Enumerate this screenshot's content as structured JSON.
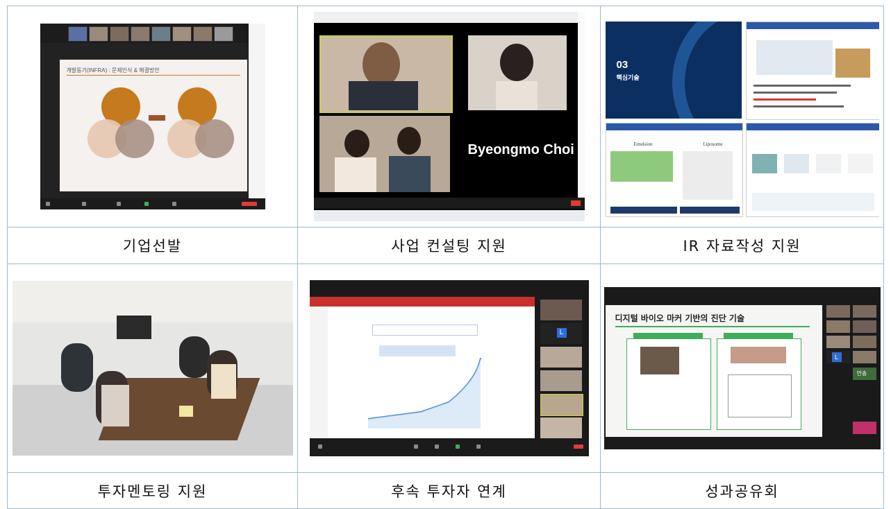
{
  "captions": {
    "c1": "기업선발",
    "c2": "사업 컨설팅 지원",
    "c3": "IR 자료작성 지원",
    "c4": "투자멘토링 지원",
    "c5": "후속 투자자 연계",
    "c6": "성과공유회"
  },
  "shot1": {
    "slide_title": "개발동기(INFRA) : 문제인식 & 해결방안"
  },
  "shot2": {
    "speaker_name": "Byeongmo Choi"
  },
  "shot3": {
    "chapter_no": "03",
    "chapter_title": "핵심기술",
    "panel_b_label1": "Emulsion",
    "panel_b_label2": "Liposome"
  },
  "shot6": {
    "slide_title": "디지털 바이오 마커 기반의 진단 기술",
    "badge_l": "L",
    "tile_text": "안송"
  },
  "shot5": {
    "badge_l": "L"
  },
  "colors": {
    "grid_line": "#9fb9c9",
    "zoom_dark": "#1b1b1b",
    "leave_red": "#e03a3a",
    "slide_green": "#3fae5a",
    "slide_orange": "#c67a1e"
  }
}
